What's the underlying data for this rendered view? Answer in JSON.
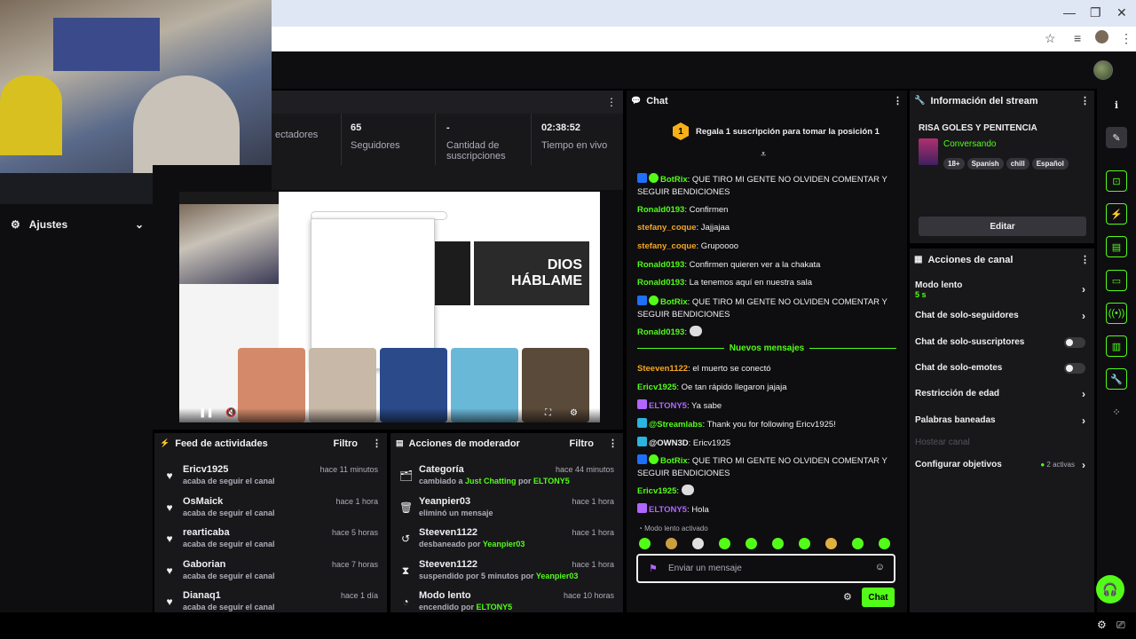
{
  "stats": {
    "items": [
      {
        "value": "",
        "label": "ectadores"
      },
      {
        "value": "65",
        "label": "Seguidores"
      },
      {
        "value": "-",
        "label": "Cantidad de suscripciones"
      },
      {
        "value": "02:38:52",
        "label": "Tiempo en vivo"
      }
    ]
  },
  "left": {
    "settings_label": "Ajustes"
  },
  "video": {
    "thumb_title": "DIOS HÁBLAME"
  },
  "activity_feed": {
    "title": "Feed de actividades",
    "filter": "Filtro",
    "items": [
      {
        "name": "Ericv1925",
        "sub": "acaba de seguir el canal",
        "time": "hace 11 minutos"
      },
      {
        "name": "OsMaick",
        "sub": "acaba de seguir el canal",
        "time": "hace 1 hora"
      },
      {
        "name": "rearticaba",
        "sub": "acaba de seguir el canal",
        "time": "hace 5 horas"
      },
      {
        "name": "Gaborian",
        "sub": "acaba de seguir el canal",
        "time": "hace 7 horas"
      },
      {
        "name": "Dianaq1",
        "sub": "acaba de seguir el canal",
        "time": "hace 1 día"
      }
    ]
  },
  "mod_actions": {
    "title": "Acciones de moderador",
    "filter": "Filtro",
    "items": [
      {
        "name": "Categoría",
        "pre": "cambiado a ",
        "hl1": "Just Chatting",
        "mid": " por ",
        "hl2": "ELTONY5",
        "time": "hace 44 minutos",
        "icon": "🗂"
      },
      {
        "name": "Yeanpier03",
        "pre": "eliminó un mensaje",
        "hl1": "",
        "mid": "",
        "hl2": "",
        "time": "hace 1 hora",
        "icon": "🗑"
      },
      {
        "name": "Steeven1122",
        "pre": "desbaneado por ",
        "hl1": "Yeanpier03",
        "mid": "",
        "hl2": "",
        "time": "hace 1 hora",
        "icon": "↺"
      },
      {
        "name": "Steeven1122",
        "pre": "suspendido por 5 minutos por ",
        "hl1": "Yeanpier03",
        "mid": "",
        "hl2": "",
        "time": "hace 1 hora",
        "icon": "⧗"
      },
      {
        "name": "Modo lento",
        "pre": "encendido por ",
        "hl1": "ELTONY5",
        "mid": "",
        "hl2": "",
        "time": "hace 10 horas",
        "icon": "◔"
      }
    ]
  },
  "chat": {
    "title": "Chat",
    "pinned": "Regala 1 suscripción para tomar la posición 1",
    "pinned_rank": "1",
    "new_messages": "Nuevos mensajes",
    "slow_mode": "Modo lento activado",
    "input_placeholder": "Enviar un mensaje",
    "send": "Chat",
    "messages": [
      {
        "user": "BotRix",
        "color": "#53fc18",
        "text": ": QUE TIRO MI GENTE NO OLVIDEN COMENTAR Y SEGUIR BENDICIONES"
      },
      {
        "user": "Ronald0193",
        "color": "#53fc18",
        "text": ": Confirmen"
      },
      {
        "user": "stefany_coque",
        "color": "#f5a623",
        "text": ": Jajjajaa"
      },
      {
        "user": "stefany_coque",
        "color": "#f5a623",
        "text": ": Grupoooo"
      },
      {
        "user": "Ronald0193",
        "color": "#53fc18",
        "text": ": Confirmen quieren ver a la chakata"
      },
      {
        "user": "Ronald0193",
        "color": "#53fc18",
        "text": ": La tenemos aquí en nuestra sala"
      },
      {
        "user": "BotRix",
        "color": "#53fc18",
        "text": ": QUE TIRO MI GENTE NO OLVIDEN COMENTAR Y SEGUIR BENDICIONES"
      },
      {
        "user": "Ronald0193",
        "color": "#53fc18",
        "text": ":"
      },
      {
        "user": "Steeven1122",
        "color": "#f5a623",
        "text": ": el muerto se conectó"
      },
      {
        "user": "Ericv1925",
        "color": "#53fc18",
        "text": ": Oe tan rápido llegaron jajaja"
      },
      {
        "user": "ELTONY5",
        "color": "#b066ff",
        "text": ": Ya sabe"
      },
      {
        "user": "@Streamlabs",
        "color": "#53fc18",
        "text": ": Thank you for following Ericv1925!"
      },
      {
        "user": "@OWN3D",
        "color": "#efeff1",
        "text": ": Ericv1925"
      },
      {
        "user": "BotRix",
        "color": "#53fc18",
        "text": ": QUE TIRO MI GENTE NO OLVIDEN COMENTAR Y SEGUIR BENDICIONES"
      },
      {
        "user": "Ericv1925",
        "color": "#53fc18",
        "text": ":"
      },
      {
        "user": "ELTONY5",
        "color": "#b066ff",
        "text": ": Hola"
      }
    ]
  },
  "stream_info": {
    "title": "Información del stream",
    "stream_title": "RISA GOLES Y PENITENCIA",
    "category": "Conversando",
    "tags": [
      "18+",
      "Spanish",
      "chill",
      "Español"
    ],
    "edit": "Editar"
  },
  "channel_actions": {
    "title": "Acciones de canal",
    "slow_mode": "Modo lento",
    "slow_mode_value": "5 s",
    "followers_only": "Chat de solo-seguidores",
    "subs_only": "Chat de solo-suscriptores",
    "emotes_only": "Chat de solo-emotes",
    "age_restriction": "Restricción de edad",
    "banned_words": "Palabras baneadas",
    "host": "Hostear canal",
    "goals": "Configurar objetivos",
    "goals_active": "2 activas"
  },
  "colors": {
    "accent": "#53fc18",
    "panel": "#18181b",
    "bg": "#0e0e10"
  }
}
